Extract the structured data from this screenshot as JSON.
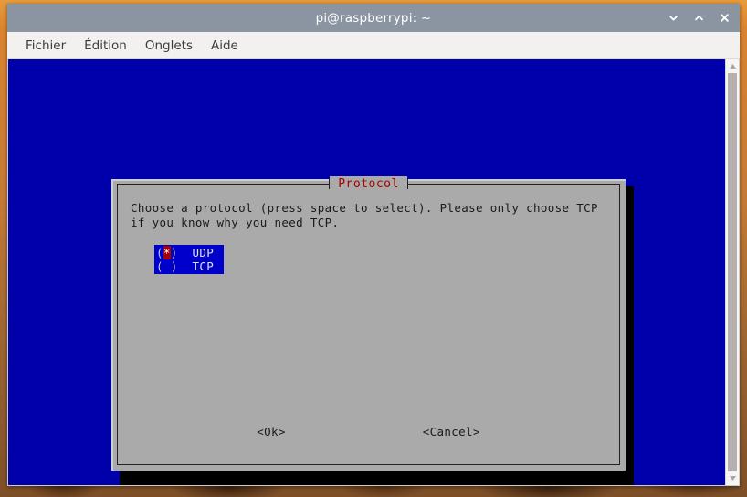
{
  "window": {
    "title": "pi@raspberrypi: ~",
    "controls": [
      {
        "name": "minimize",
        "icon": "chevron-down-icon"
      },
      {
        "name": "maximize",
        "icon": "chevron-up-icon"
      },
      {
        "name": "close",
        "icon": "close-icon"
      }
    ]
  },
  "menubar": {
    "items": [
      {
        "label": "Fichier"
      },
      {
        "label": "Édition"
      },
      {
        "label": "Onglets"
      },
      {
        "label": "Aide"
      }
    ]
  },
  "terminal": {
    "background_color": "#0000aa"
  },
  "scrollbar": {
    "up_arrow": "triangle-up-icon",
    "down_arrow": "triangle-down-icon",
    "thumb_color": "#b3b0ad"
  },
  "dialog": {
    "title": "Protocol",
    "title_color": "#aa0000",
    "background_color": "#aaaaaa",
    "message_line_1": "Choose a protocol (press space to select). Please only choose TCP",
    "message_line_2": "if you know why you need TCP.",
    "options": [
      {
        "marker_open": "(",
        "marker_state": "*",
        "marker_close": ")",
        "label": "UDP",
        "selected": true
      },
      {
        "marker_open": "(",
        "marker_state": " ",
        "marker_close": ")",
        "label": "TCP",
        "selected": false
      }
    ],
    "selection_color": "#0000cc",
    "marker_highlight_color": "#aa0000",
    "buttons": [
      {
        "label": "<Ok>"
      },
      {
        "label": "<Cancel>"
      }
    ]
  }
}
